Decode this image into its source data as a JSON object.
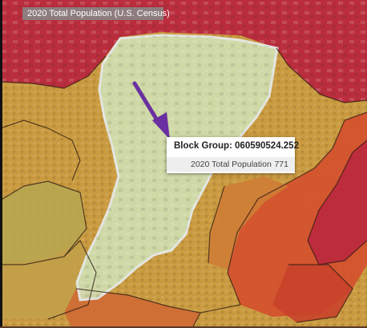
{
  "map": {
    "layer_title": "2020 Total Population (U.S. Census)",
    "colors": {
      "high": "#b8243d",
      "mid_high": "#d4502e",
      "mid": "#c99a3f",
      "low": "#a7b868",
      "selected_fill": "#cfe0b2",
      "selected_outline": "#e8eef2",
      "arrow": "#6a2fa0",
      "boundary": "#2a1a12"
    }
  },
  "popup": {
    "title": "Block Group: 060590524.252",
    "field_label": "2020 Total Population",
    "field_value": "771"
  }
}
